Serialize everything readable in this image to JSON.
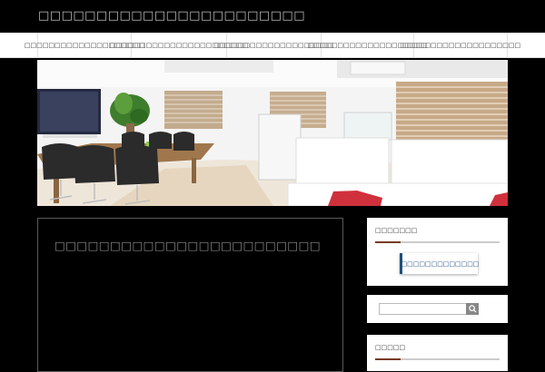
{
  "site": {
    "title": "□□□□□□□□□□□□□□□□□□□□□□□"
  },
  "nav": {
    "items": [
      {
        "label": "□□□□□□□□□□□□□□□□□□□□"
      },
      {
        "label": "□□□□□□□□□□□□□□□□□□□□□□□"
      },
      {
        "label": "□□□□□□□□□□□□□□□□□□□□"
      },
      {
        "label": "□□□□□□□□□□□□□□□□□□□□"
      },
      {
        "label": "□□□□□□□□□□□□□□□□□□□□"
      }
    ]
  },
  "main": {
    "title": "□□□□□□□□□□□□□□□□□□□□□□□□"
  },
  "sidebar": {
    "widget1": {
      "title": "□□□□□□□",
      "button_label": "□□□□□□□□□□□□□"
    },
    "widget2": {
      "search_placeholder": ""
    },
    "widget3": {
      "title": "□□□□□"
    }
  },
  "colors": {
    "background": "#000000",
    "accent": "#7a3a26",
    "link": "#1f4f7a"
  }
}
